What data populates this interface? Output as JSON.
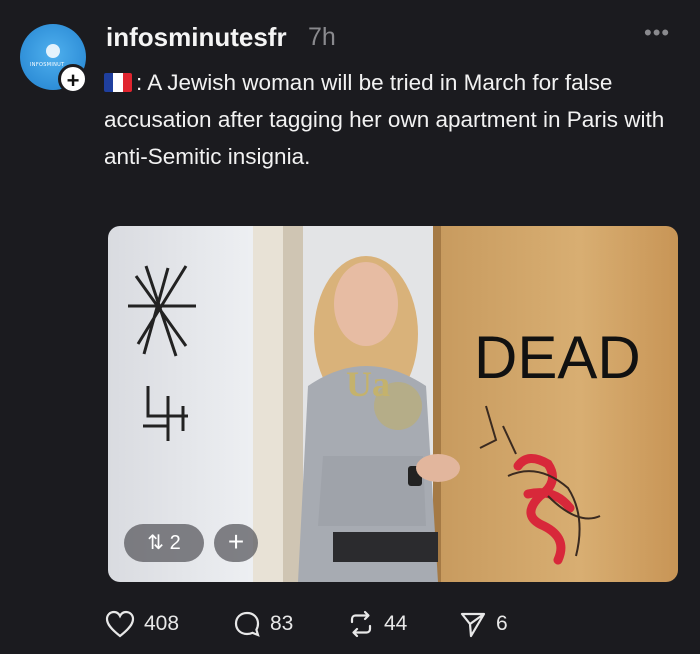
{
  "post": {
    "username": "infosminutesfr",
    "time": "7h",
    "more": "•••",
    "avatar_text": "INFOSMINUT",
    "follow": "+",
    "flag": "french-flag-icon",
    "text": ": A Jewish woman will be tried in March for false accusation after tagging her own apartment in Paris with anti-Semitic insignia."
  },
  "media": {
    "door_text": "DEAD",
    "sweatshirt_text": "Ua",
    "repost_count": "2",
    "add_label": "+"
  },
  "actions": {
    "likes": "408",
    "replies": "83",
    "reposts": "44",
    "shares": "6"
  },
  "colors": {
    "background": "#1b1b1f",
    "text": "#f2f2f2",
    "muted": "#8a8a8e",
    "avatar": "#2f8fd8",
    "graffiti_red": "#d8283a"
  }
}
